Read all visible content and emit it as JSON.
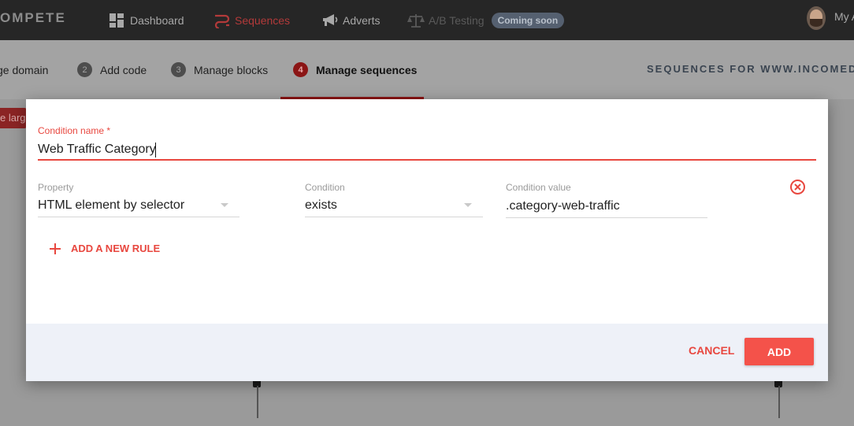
{
  "nav": {
    "brand": "OMPETE",
    "items": [
      {
        "label": "Dashboard",
        "icon": "dashboard-icon"
      },
      {
        "label": "Sequences",
        "icon": "sequences-icon"
      },
      {
        "label": "Adverts",
        "icon": "megaphone-icon"
      },
      {
        "label": "A/B Testing",
        "icon": "scales-icon"
      }
    ],
    "coming_soon_badge": "Coming soon",
    "account_label": "My A"
  },
  "steps": [
    {
      "label": "ge domain"
    },
    {
      "number": "2",
      "label": "Add code"
    },
    {
      "number": "3",
      "label": "Manage blocks"
    },
    {
      "number": "4",
      "label": "Manage sequences"
    }
  ],
  "sequences_title": "SEQUENCES FOR WWW.INCOMED",
  "background_tag": "e larg",
  "modal": {
    "condition_name_label": "Condition name *",
    "condition_name_value": "Web Traffic Category",
    "property_label": "Property",
    "property_value": "HTML element by selector",
    "condition_label": "Condition",
    "condition_value": "exists",
    "condition_value_label": "Condition value",
    "condition_value_value": ".category-web-traffic",
    "add_rule_label": "ADD A NEW RULE",
    "cancel_label": "CANCEL",
    "add_label": "ADD"
  },
  "colors": {
    "accent": "#e8473f",
    "nav_bg": "#262626",
    "footer_bg": "#eef1f8",
    "active_step": "#8b1515"
  }
}
